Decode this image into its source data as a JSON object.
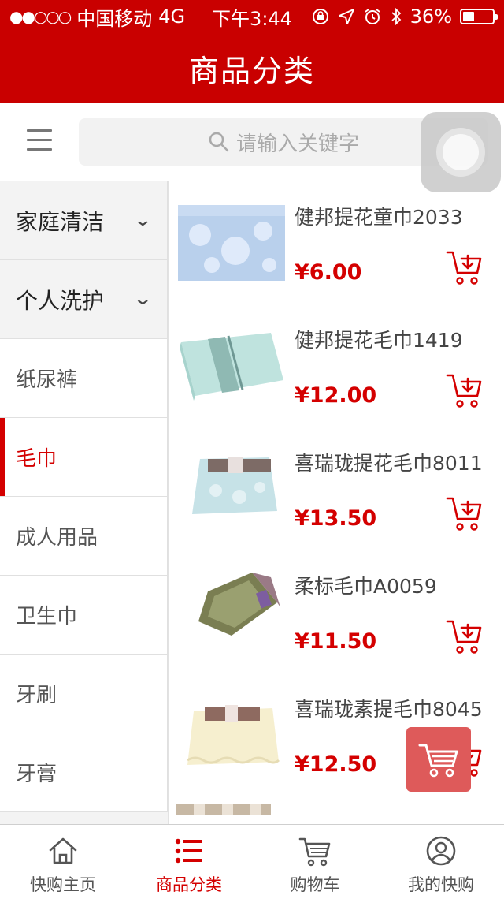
{
  "status_bar": {
    "carrier": "中国移动",
    "network": "4G",
    "time": "下午3:44",
    "battery": "36%",
    "battery_level": 0.36,
    "signal_icon": "signal-dots-icon",
    "icons": [
      "rotation-lock-icon",
      "location-icon",
      "alarm-icon",
      "bluetooth-icon",
      "battery-icon"
    ]
  },
  "header": {
    "title": "商品分类"
  },
  "search": {
    "placeholder": "请输入关键字",
    "icon": "search-icon"
  },
  "sidebar": {
    "categories": [
      {
        "label": "家庭清洁",
        "type": "group",
        "expanded": false
      },
      {
        "label": "个人洗护",
        "type": "group",
        "expanded": false
      },
      {
        "label": "纸尿裤",
        "type": "item"
      },
      {
        "label": "毛巾",
        "type": "item",
        "active": true
      },
      {
        "label": "成人用品",
        "type": "item"
      },
      {
        "label": "卫生巾",
        "type": "item"
      },
      {
        "label": "牙刷",
        "type": "item"
      },
      {
        "label": "牙膏",
        "type": "item"
      }
    ]
  },
  "products": [
    {
      "name": "健邦提花童巾2033",
      "price": "¥6.00"
    },
    {
      "name": "健邦提花毛巾1419",
      "price": "¥12.00"
    },
    {
      "name": "喜瑞珑提花毛巾8011",
      "price": "¥13.50"
    },
    {
      "name": "柔标毛巾A0059",
      "price": "¥11.50"
    },
    {
      "name": "喜瑞珑素提毛巾8045",
      "price": "¥12.50"
    }
  ],
  "tabs": [
    {
      "label": "快购主页",
      "icon": "home-icon"
    },
    {
      "label": "商品分类",
      "icon": "list-icon",
      "active": true
    },
    {
      "label": "购物车",
      "icon": "cart-icon"
    },
    {
      "label": "我的快购",
      "icon": "user-icon"
    }
  ],
  "colors": {
    "brand_red": "#c90000",
    "price_red": "#d40000",
    "float_cart": "#de5a5a"
  }
}
